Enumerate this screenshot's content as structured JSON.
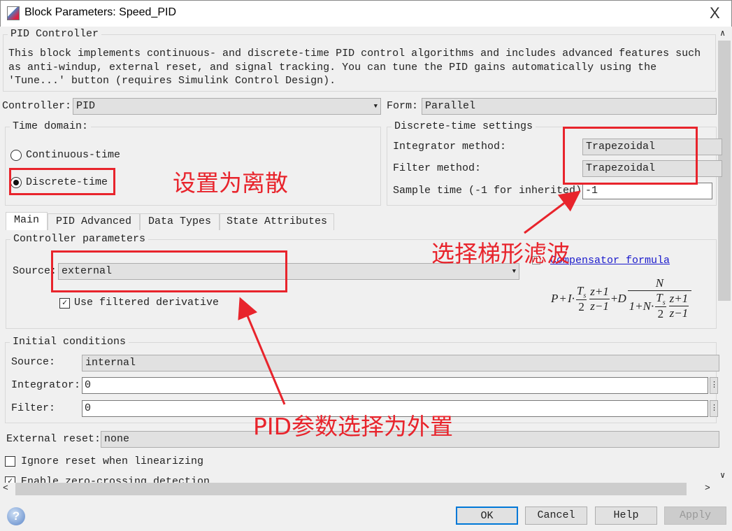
{
  "window": {
    "title": "Block Parameters: Speed_PID",
    "close": "X"
  },
  "header": {
    "group_title": "PID Controller",
    "description": "This block implements continuous- and discrete-time PID control algorithms and includes advanced features such as anti-windup, external reset, and signal tracking. You can tune the PID gains automatically using the 'Tune...' button (requires Simulink Control Design)."
  },
  "controller": {
    "label": "Controller:",
    "value": "PID",
    "form_label": "Form:",
    "form_value": "Parallel"
  },
  "time_domain": {
    "title": "Time domain:",
    "options": [
      {
        "label": "Continuous-time",
        "selected": false
      },
      {
        "label": "Discrete-time",
        "selected": true
      }
    ]
  },
  "discrete": {
    "title": "Discrete-time settings",
    "integrator_label": "Integrator method:",
    "integrator_value": "Trapezoidal",
    "filter_label": "Filter method:",
    "filter_value": "Trapezoidal",
    "sample_label": "Sample time (-1 for inherited):",
    "sample_value": "-1"
  },
  "tabs": [
    {
      "label": "Main",
      "selected": true
    },
    {
      "label": "PID Advanced"
    },
    {
      "label": "Data Types"
    },
    {
      "label": "State Attributes"
    }
  ],
  "controller_params": {
    "title": "Controller parameters",
    "source_label": "Source:",
    "source_value": "external",
    "filtered_derivative": "Use filtered derivative",
    "filtered_checked": true,
    "formula_link": "Compensator formula"
  },
  "formula": {
    "P": "P",
    "plus": "+",
    "I": "I·",
    "Ts": "T",
    "s": "s",
    "two": "2",
    "zp1": "z+1",
    "zm1": "z−1",
    "D": "D",
    "N": "N",
    "den": "1+N·"
  },
  "initial": {
    "title": "Initial conditions",
    "source_label": "Source:",
    "source_value": "internal",
    "integrator_label": "Integrator:",
    "integrator_value": "0",
    "filter_label": "Filter:",
    "filter_value": "0",
    "ellipsis": "⋮"
  },
  "external_reset": {
    "label": "External reset:",
    "value": "none"
  },
  "ignore_reset": {
    "label": "Ignore reset when linearizing",
    "checked": false
  },
  "zero_crossing": {
    "label": "Enable zero-crossing detection",
    "checked": true
  },
  "buttons": {
    "ok": "OK",
    "cancel": "Cancel",
    "help": "Help",
    "apply": "Apply"
  },
  "annotations": {
    "discrete": "设置为离散",
    "trapezoidal": "选择梯形滤波",
    "external": "PID参数选择为外置"
  },
  "colors": {
    "annotation": "#e8242c",
    "link": "#1a1acc",
    "focus": "#0078d7"
  }
}
